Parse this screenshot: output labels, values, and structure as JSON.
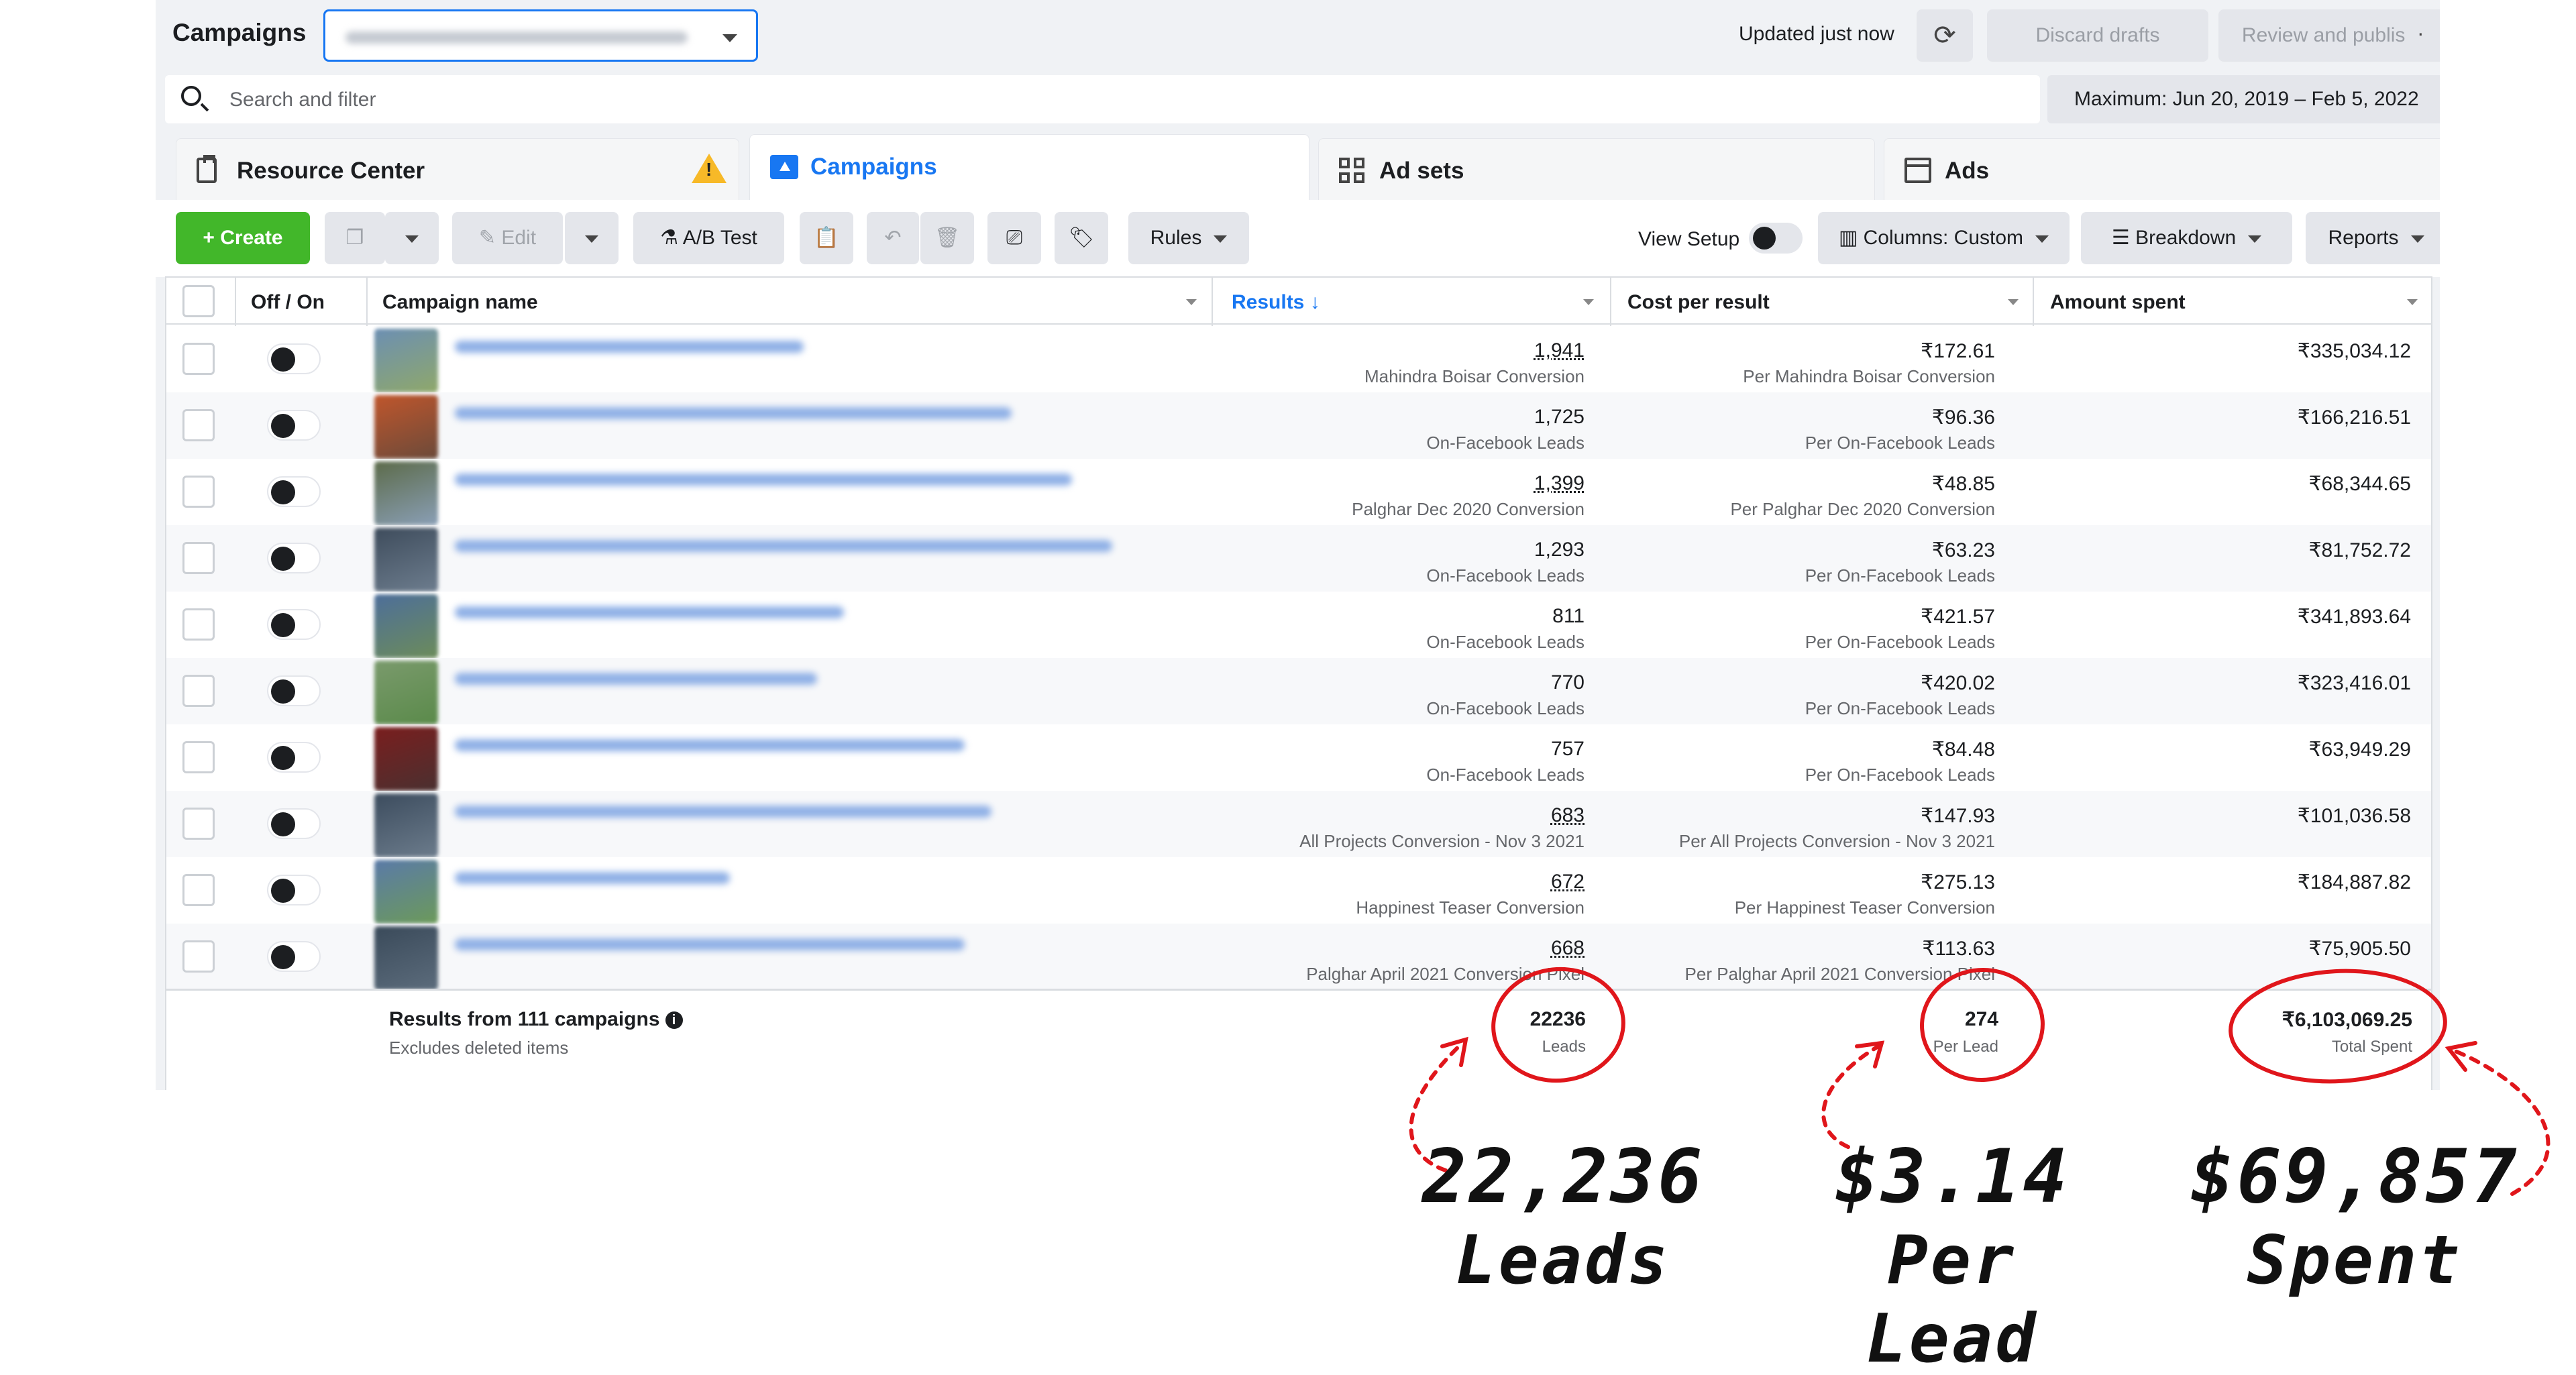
{
  "header": {
    "title": "Campaigns",
    "updated": "Updated just now",
    "discard_label": "Discard drafts",
    "review_label": "Review and publish"
  },
  "search": {
    "placeholder": "Search and filter",
    "date_range": "Maximum: Jun 20, 2019 – Feb 5, 2022"
  },
  "tabs": [
    {
      "label": "Resource Center",
      "icon": "clipboard-icon"
    },
    {
      "label": "Campaigns",
      "icon": "folder-icon",
      "active": true
    },
    {
      "label": "Ad sets",
      "icon": "grid-icon"
    },
    {
      "label": "Ads",
      "icon": "window-icon"
    }
  ],
  "toolbar": {
    "create": "Create",
    "edit": "Edit",
    "ab_test": "A/B Test",
    "rules": "Rules",
    "view_setup": "View Setup",
    "columns": "Columns: Custom",
    "breakdown": "Breakdown",
    "reports": "Reports"
  },
  "columns": {
    "toggle": "Off / On",
    "name": "Campaign name",
    "results": "Results",
    "cost": "Cost per result",
    "spent": "Amount spent"
  },
  "rows": [
    {
      "results": "1,941",
      "results_label": "Mahindra Boisar Conversion",
      "cost": "₹172.61",
      "cost_label": "Per Mahindra Boisar Conversion",
      "spent": "₹335,034.12"
    },
    {
      "results": "1,725",
      "results_label": "On-Facebook Leads",
      "cost": "₹96.36",
      "cost_label": "Per On-Facebook Leads",
      "spent": "₹166,216.51"
    },
    {
      "results": "1,399",
      "results_label": "Palghar Dec 2020 Conversion",
      "cost": "₹48.85",
      "cost_label": "Per Palghar Dec 2020 Conversion",
      "spent": "₹68,344.65"
    },
    {
      "results": "1,293",
      "results_label": "On-Facebook Leads",
      "cost": "₹63.23",
      "cost_label": "Per On-Facebook Leads",
      "spent": "₹81,752.72"
    },
    {
      "results": "811",
      "results_label": "On-Facebook Leads",
      "cost": "₹421.57",
      "cost_label": "Per On-Facebook Leads",
      "spent": "₹341,893.64"
    },
    {
      "results": "770",
      "results_label": "On-Facebook Leads",
      "cost": "₹420.02",
      "cost_label": "Per On-Facebook Leads",
      "spent": "₹323,416.01"
    },
    {
      "results": "757",
      "results_label": "On-Facebook Leads",
      "cost": "₹84.48",
      "cost_label": "Per On-Facebook Leads",
      "spent": "₹63,949.29"
    },
    {
      "results": "683",
      "results_label": "All Projects Conversion - Nov 3 2021",
      "cost": "₹147.93",
      "cost_label": "Per All Projects Conversion - Nov 3 2021",
      "spent": "₹101,036.58"
    },
    {
      "results": "672",
      "results_label": "Happinest Teaser Conversion",
      "cost": "₹275.13",
      "cost_label": "Per Happinest Teaser Conversion",
      "spent": "₹184,887.82"
    },
    {
      "results": "668",
      "results_label": "Palghar April 2021 Conversion Pixel",
      "cost": "₹113.63",
      "cost_label": "Per Palghar April 2021 Conversion Pixel",
      "spent": "₹75,905.50"
    }
  ],
  "footer": {
    "title": "Results from 111 campaigns",
    "subtitle": "Excludes deleted items",
    "results": "22236",
    "results_unit": "Leads",
    "cost": "274",
    "cost_unit": "Per Lead",
    "spent": "₹6,103,069.25",
    "spent_unit": "Total Spent"
  },
  "annotations": {
    "leads_value": "22,236",
    "leads_label": "Leads",
    "cpl_value": "$3.14",
    "cpl_label": "Per Lead",
    "spent_value": "$69,857",
    "spent_label": "Spent",
    "circle_color": "#e0161b"
  }
}
